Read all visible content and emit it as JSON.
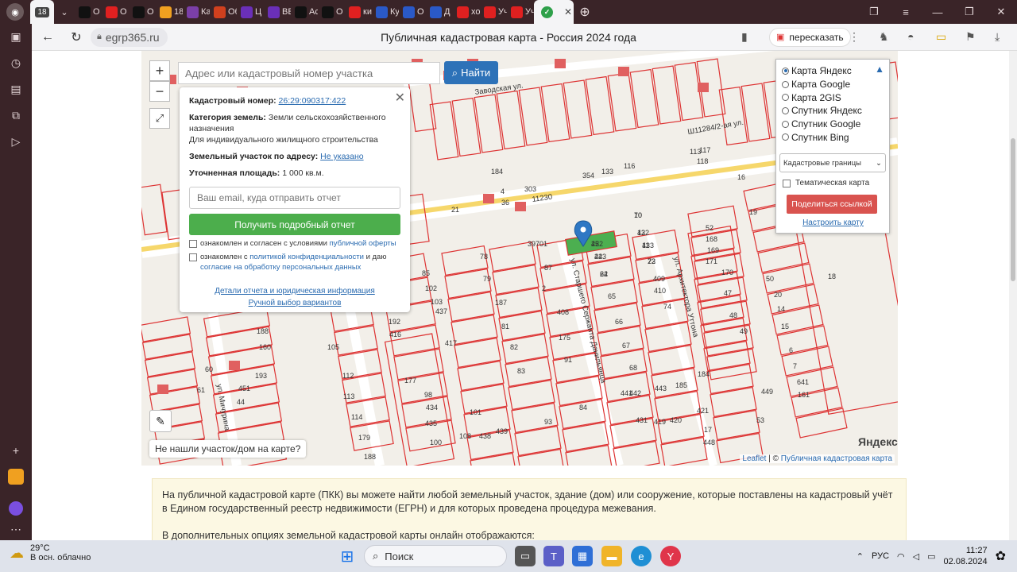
{
  "browser": {
    "active_tab_label": "18",
    "tabs": [
      {
        "label": "О",
        "color": "#111111"
      },
      {
        "label": "О",
        "color": "#e02020"
      },
      {
        "label": "О",
        "color": "#111111"
      },
      {
        "label": "18",
        "color": "#f0a020"
      },
      {
        "label": "Ка",
        "color": "#7b3fa8"
      },
      {
        "label": "Об",
        "color": "#d0401e"
      },
      {
        "label": "Ц",
        "color": "#6a2fb8"
      },
      {
        "label": "ВЕ",
        "color": "#6a2fb8"
      },
      {
        "label": "Ас",
        "color": "#111111"
      },
      {
        "label": "О",
        "color": "#111111"
      },
      {
        "label": "ки",
        "color": "#e02020"
      },
      {
        "label": "Ку",
        "color": "#2a59c8"
      },
      {
        "label": "О",
        "color": "#2a59c8"
      },
      {
        "label": "Д",
        "color": "#2a59c8"
      },
      {
        "label": "хо",
        "color": "#e02020"
      },
      {
        "label": "Уч",
        "color": "#e02020"
      },
      {
        "label": "Уч",
        "color": "#e02020"
      }
    ],
    "domain": "egrp365.ru",
    "title": "Публичная кадастровая карта - Россия 2024 года",
    "retell_label": "пересказать"
  },
  "map": {
    "search_placeholder": "Адрес или кадастровый номер участка",
    "search_button": "Найти",
    "zoom_in": "+",
    "zoom_out": "−",
    "not_found": "Не нашли участок/дом на карте?",
    "yandex_logo": "Яндекс",
    "attribution_leaflet": "Leaflet",
    "attribution_sep": " | © ",
    "attribution_source": "Публичная кадастровая карта"
  },
  "popup": {
    "cadastral_label": "Кадастровый номер:",
    "cadastral_value": "26:29:090317:422",
    "category_label": "Категория земель:",
    "category_value": "Земли сельскохозяйственного назначения",
    "category_use": "Для индивидуального жилищного строительства",
    "address_label": "Земельный участок по адресу:",
    "address_value": "Не указано",
    "area_label": "Уточненная площадь:",
    "area_value": "1 000 кв.м.",
    "email_placeholder": "Ваш email, куда отправить отчет",
    "report_button": "Получить подробный отчет",
    "consent1_text": "ознакомлен и согласен с условиями",
    "consent1_link": "публичной оферты",
    "consent2_text": "ознакомлен с",
    "consent2_link": "политикой конфиденциальности",
    "consent2_text2": "и даю",
    "consent2_link2": "согласие на обработку персональных данных",
    "details_link": "Детали отчета и юридическая информация",
    "manual_link": "Ручной выбор вариантов"
  },
  "layers": {
    "options": [
      "Карта Яндекс",
      "Карта Google",
      "Карта 2GIS",
      "Спутник Яндекс",
      "Спутник Google",
      "Спутник Bing"
    ],
    "selected_index": 0,
    "select_value": "Кадастровые границы",
    "thematic_label": "Тематическая карта",
    "share_button": "Поделиться ссылкой",
    "setup_link": "Настроить карту"
  },
  "map_labels": {
    "streets": [
      "Заводская ул.",
      "ул. Старшего Сержанта Данильянца",
      "ул. Архитектора Уттона",
      "ул. Мичурина",
      "Ш11284/2-ая ул.",
      "11230"
    ],
    "parcels": [
      "70",
      "432",
      "433",
      "422",
      "423",
      "72",
      "64",
      "409",
      "410",
      "65",
      "74",
      "66",
      "67",
      "68",
      "441",
      "442",
      "443",
      "185",
      "184",
      "39701",
      "78",
      "87",
      "79",
      "2",
      "187",
      "408",
      "81",
      "175",
      "82",
      "91",
      "83",
      "84",
      "93",
      "85",
      "102",
      "103",
      "437",
      "192",
      "416",
      "417",
      "105",
      "112",
      "113",
      "114",
      "179",
      "188",
      "177",
      "98",
      "434",
      "435",
      "100",
      "101",
      "108",
      "438",
      "439",
      "431",
      "419",
      "420",
      "421",
      "17",
      "448",
      "449",
      "53",
      "52",
      "168",
      "169",
      "171",
      "170",
      "47",
      "48",
      "49",
      "50",
      "20",
      "14",
      "15",
      "16",
      "19",
      "18",
      "21",
      "4",
      "36",
      "303",
      "354",
      "133",
      "116",
      "117",
      "118",
      "113",
      "184",
      "44",
      "451",
      "61",
      "60",
      "188",
      "193",
      "160",
      "161",
      "641",
      "7",
      "6",
      "10",
      "12",
      "11",
      "25",
      "24",
      "23",
      "22"
    ],
    "selected_parcel": "422"
  },
  "info_text": "На публичной кадастровой карте (ПКК) вы можете найти любой земельный участок, здание (дом) или сооружение, которые поставлены на кадастровый учёт в Едином государственный реестр недвижимости (ЕГРН) и для которых проведена процедура межевания.",
  "info_text2": "В дополнительных опциях земельной кадастровой карты онлайн отображаются:",
  "taskbar": {
    "temperature": "29°C",
    "weather": "В осн. облачно",
    "search": "Поиск",
    "lang": "РУС",
    "time": "11:27",
    "date": "02.08.2024"
  }
}
